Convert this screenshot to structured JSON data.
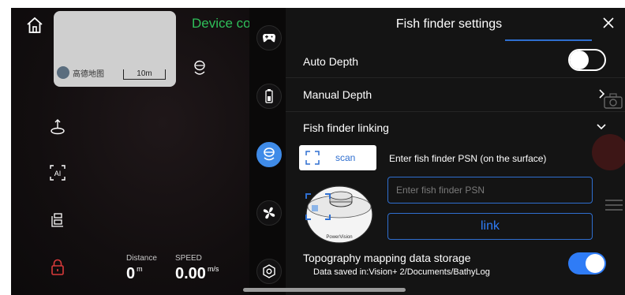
{
  "camera_view": {
    "device_status_title": "Device con",
    "map": {
      "logo_text": "高德地图",
      "scale_label": "10m"
    },
    "stats": {
      "distance_label": "Distance",
      "distance_value": "0",
      "distance_unit": "m",
      "speed_label": "SPEED",
      "speed_value": "0.00",
      "speed_unit": "m/s"
    },
    "left_toolbar_icons": [
      "return-home-icon",
      "ai-icon",
      "route-icon",
      "lock-icon"
    ],
    "side_strip_icons": [
      "gamepad-icon",
      "battery-icon",
      "fish-finder-icon",
      "fan-icon",
      "settings-hex-icon"
    ]
  },
  "settings_panel": {
    "title": "Fish finder settings",
    "auto_depth_label": "Auto Depth",
    "auto_depth_on": false,
    "manual_depth_label": "Manual Depth",
    "linking_label": "Fish finder linking",
    "scan_label": "scan",
    "psn_title": "Enter fish finder PSN (on the surface)",
    "psn_placeholder": "Enter fish finder PSN",
    "psn_value": "",
    "link_label": "link",
    "device_brand": "PowerVision",
    "topography_label": "Topography mapping data storage",
    "topography_on": true,
    "data_saved_text": "Data saved in:Vision+ 2/Documents/BathyLog"
  },
  "colors": {
    "accent_blue": "#2f7cf6",
    "status_green": "#2fbf5a",
    "panel_bg": "#141414",
    "lock_red": "#d83a3a"
  }
}
